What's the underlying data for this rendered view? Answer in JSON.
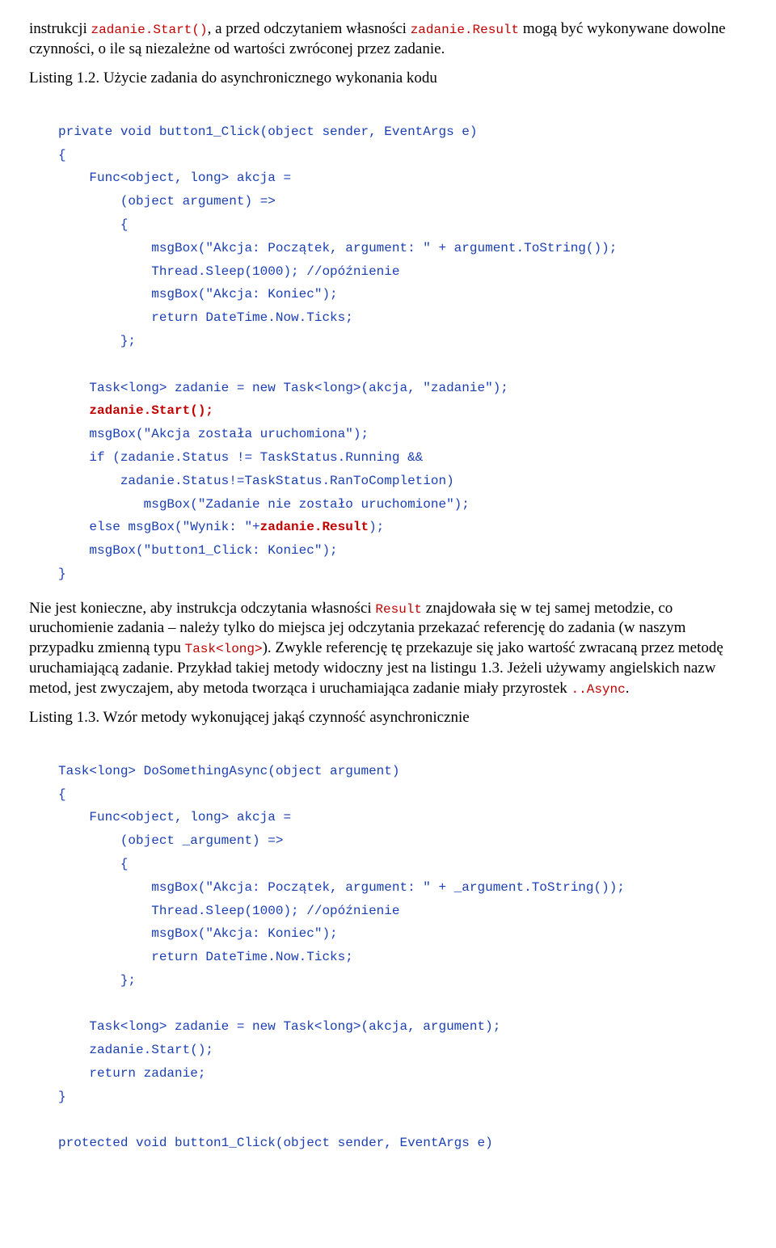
{
  "para1": {
    "pre1": "instrukcji ",
    "code1": "zadanie.Start()",
    "mid1": ", a przed odczytaniem własności ",
    "code2": "zadanie.Result",
    "post1": " mogą być wykonywane dowolne czynności, o ile są niezależne od wartości zwróconej przez zadanie."
  },
  "listing12": "Listing 1.2. Użycie zadania do asynchronicznego wykonania kodu",
  "codeblock1": {
    "l1": "private void button1_Click(object sender, EventArgs e)",
    "l2": "{",
    "l3": "    Func<object, long> akcja =",
    "l4": "        (object argument) =>",
    "l5": "        {",
    "l6": "            msgBox(\"Akcja: Początek, argument: \" + argument.ToString());",
    "l7": "            Thread.Sleep(1000); //opóźnienie",
    "l8": "            msgBox(\"Akcja: Koniec\");",
    "l9": "            return DateTime.Now.Ticks;",
    "l10": "        };",
    "l11": "",
    "l12": "    Task<long> zadanie = new Task<long>(akcja, \"zadanie\");",
    "l13a": "    ",
    "l13b": "zadanie.Start();",
    "l14": "    msgBox(\"Akcja została uruchomiona\");",
    "l15": "    if (zadanie.Status != TaskStatus.Running &&",
    "l16": "        zadanie.Status!=TaskStatus.RanToCompletion)",
    "l17": "           msgBox(\"Zadanie nie zostało uruchomione\");",
    "l18a": "    else msgBox(\"Wynik: \"+",
    "l18b": "zadanie.Result",
    "l18c": ");",
    "l19": "    msgBox(\"button1_Click: Koniec\");",
    "l20": "}"
  },
  "para2": {
    "pre": "Nie jest konieczne, aby instrukcja odczytania własności ",
    "code1": "Result",
    "mid1": " znajdowała się w tej samej metodzie, co uruchomienie zadania – należy tylko do miejsca jej odczytania przekazać referencję do zadania (w naszym przypadku zmienną typu ",
    "code2": "Task<long>",
    "mid2": "). Zwykle referencję tę przekazuje się jako wartość zwracaną przez metodę uruchamiającą zadanie. Przykład takiej metody widoczny jest na listingu 1.3. Jeżeli używamy angielskich nazw metod, jest zwyczajem, aby metoda tworząca i uruchamiająca zadanie miały przyrostek ",
    "code3": "..Async",
    "post": "."
  },
  "listing13": "Listing 1.3. Wzór metody wykonującej jakąś czynność asynchronicznie",
  "codeblock2": {
    "l1": "Task<long> DoSomethingAsync(object argument)",
    "l2": "{",
    "l3": "    Func<object, long> akcja =",
    "l4": "        (object _argument) =>",
    "l5": "        {",
    "l6": "            msgBox(\"Akcja: Początek, argument: \" + _argument.ToString());",
    "l7": "            Thread.Sleep(1000); //opóźnienie",
    "l8": "            msgBox(\"Akcja: Koniec\");",
    "l9": "            return DateTime.Now.Ticks;",
    "l10": "        };",
    "l11": "",
    "l12": "    Task<long> zadanie = new Task<long>(akcja, argument);",
    "l13": "    zadanie.Start();",
    "l14": "    return zadanie;",
    "l15": "}",
    "l16": "",
    "l17": "protected void button1_Click(object sender, EventArgs e)"
  }
}
